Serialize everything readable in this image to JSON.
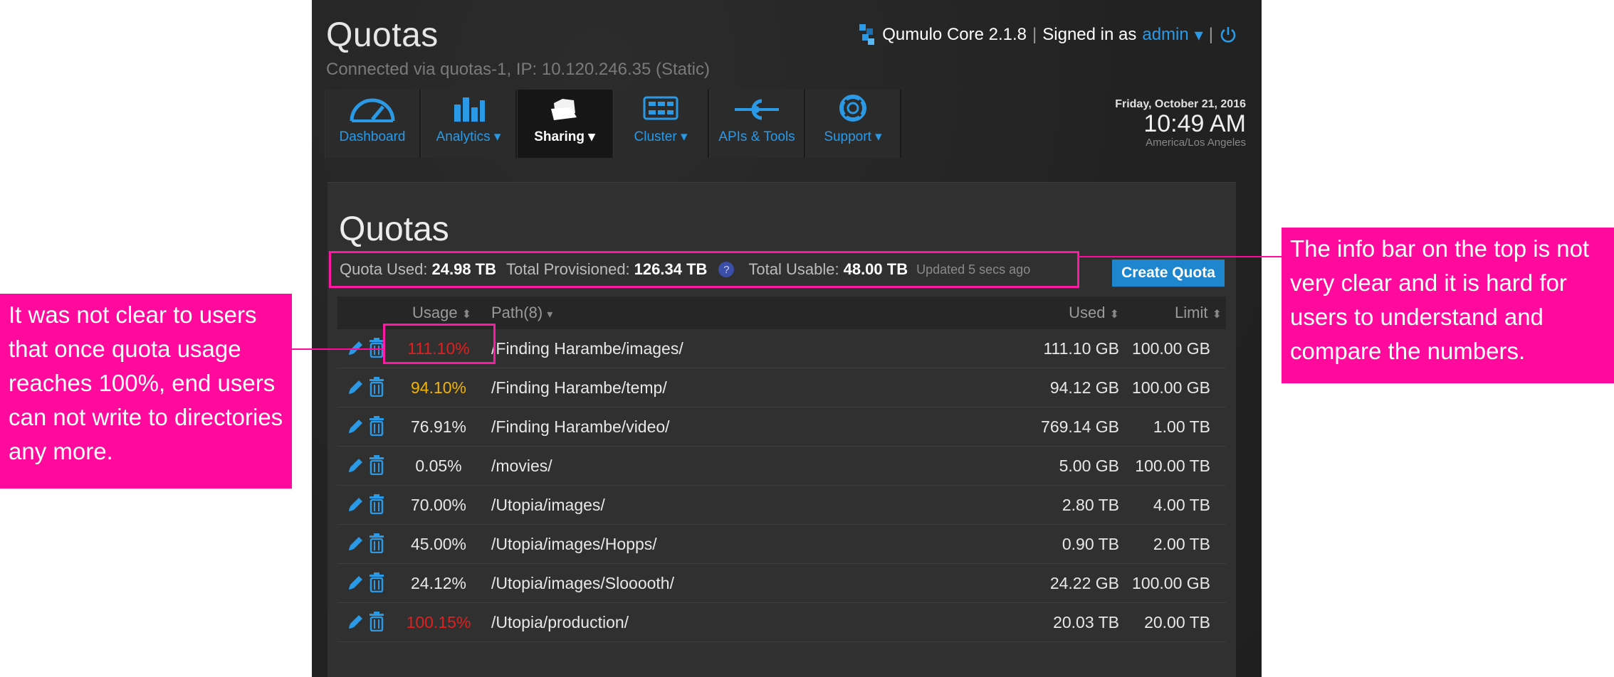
{
  "header": {
    "title": "Quotas",
    "subtitle": "Connected via quotas-1, IP: 10.120.246.35 (Static)",
    "product": "Qumulo Core 2.1.8",
    "separator": "|",
    "signed_in_label": "Signed in as",
    "user": "admin",
    "power_icon": "power-icon"
  },
  "nav": [
    {
      "label": "Dashboard",
      "icon": "gauge-icon"
    },
    {
      "label": "Analytics ▾",
      "icon": "bar-chart-icon"
    },
    {
      "label": "Sharing ▾",
      "icon": "folders-icon",
      "active": true
    },
    {
      "label": "Cluster ▾",
      "icon": "server-icon"
    },
    {
      "label": "APIs & Tools",
      "icon": "plug-icon"
    },
    {
      "label": "Support ▾",
      "icon": "lifebuoy-icon"
    }
  ],
  "clock": {
    "date": "Friday, October 21, 2016",
    "time": "10:49 AM",
    "timezone": "America/Los Angeles"
  },
  "panel": {
    "title": "Quotas",
    "info": {
      "quota_used_label": "Quota Used:",
      "quota_used": "24.98 TB",
      "provisioned_label": "Total Provisioned:",
      "provisioned": "126.34 TB",
      "help": "?",
      "usable_label": "Total Usable:",
      "usable": "48.00 TB",
      "updated": "Updated 5 secs ago"
    },
    "create_button": "Create Quota",
    "columns": {
      "usage": "Usage",
      "path": "Path(8)",
      "used": "Used",
      "limit": "Limit"
    },
    "rows": [
      {
        "usage": "111.10%",
        "path": "/Finding Harambe/images/",
        "used": "111.10 GB",
        "limit": "100.00 GB",
        "status": "over"
      },
      {
        "usage": "94.10%",
        "path": "/Finding Harambe/temp/",
        "used": "94.12 GB",
        "limit": "100.00 GB",
        "status": "warn"
      },
      {
        "usage": "76.91%",
        "path": "/Finding Harambe/video/",
        "used": "769.14 GB",
        "limit": "1.00 TB",
        "status": "ok"
      },
      {
        "usage": "0.05%",
        "path": "/movies/",
        "used": "5.00 GB",
        "limit": "100.00 TB",
        "status": "ok"
      },
      {
        "usage": "70.00%",
        "path": "/Utopia/images/",
        "used": "2.80 TB",
        "limit": "4.00 TB",
        "status": "ok"
      },
      {
        "usage": "45.00%",
        "path": "/Utopia/images/Hopps/",
        "used": "0.90 TB",
        "limit": "2.00 TB",
        "status": "ok"
      },
      {
        "usage": "24.12%",
        "path": "/Utopia/images/Slooooth/",
        "used": "24.22 GB",
        "limit": "100.00 GB",
        "status": "ok"
      },
      {
        "usage": "100.15%",
        "path": "/Utopia/production/",
        "used": "20.03 TB",
        "limit": "20.00 TB",
        "status": "over"
      }
    ]
  },
  "colors": {
    "accent": "#2a9ae6",
    "annotation": "#ff0a9c",
    "over": "#e02020",
    "warn": "#f0b400",
    "ok": "#e8e8e8"
  },
  "annotations": {
    "left": "It was not clear to users that once quota usage reaches 100%, end users can not write to directories any more.",
    "right": "The info bar on the top is not very clear and it is hard for users to understand and compare the numbers."
  }
}
